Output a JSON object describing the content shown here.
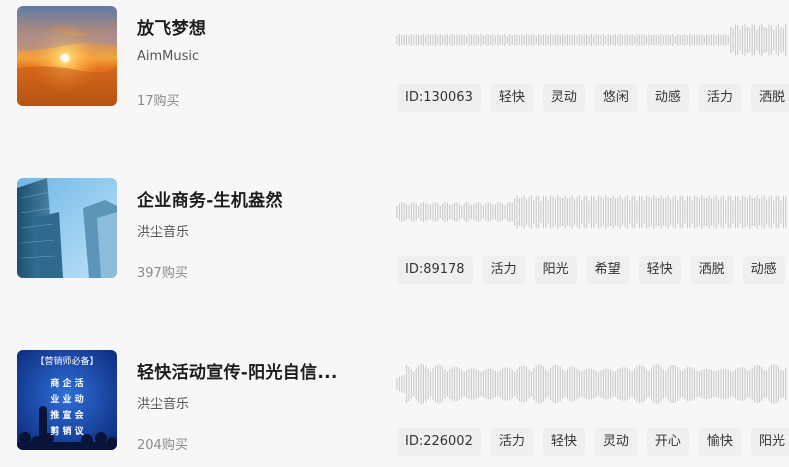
{
  "tracks": [
    {
      "title": "放飞梦想",
      "author": "AimMusic",
      "sales": "17购买",
      "tags": [
        "ID:130063",
        "轻快",
        "灵动",
        "悠闲",
        "动感",
        "活力",
        "洒脱"
      ],
      "cover": "sunset-sky"
    },
    {
      "title": "企业商务-生机盎然",
      "author": "洪尘音乐",
      "sales": "397购买",
      "tags": [
        "ID:89178",
        "活力",
        "阳光",
        "希望",
        "轻快",
        "洒脱",
        "动感"
      ],
      "cover": "skyscrapers"
    },
    {
      "title": "轻快活动宣传-阳光自信...",
      "author": "洪尘音乐",
      "sales": "204购买",
      "tags": [
        "ID:226002",
        "活力",
        "轻快",
        "灵动",
        "开心",
        "愉快",
        "阳光"
      ],
      "cover": "poster-blue",
      "cover_text": [
        "【营销师必备】",
        "商 企 活",
        "业 业 动",
        "推 宣 会",
        "剪 销 议"
      ]
    }
  ],
  "colors": {
    "background": "#f7f7f7",
    "tag_bg": "#efefef",
    "wave": "#c6c6c6"
  }
}
